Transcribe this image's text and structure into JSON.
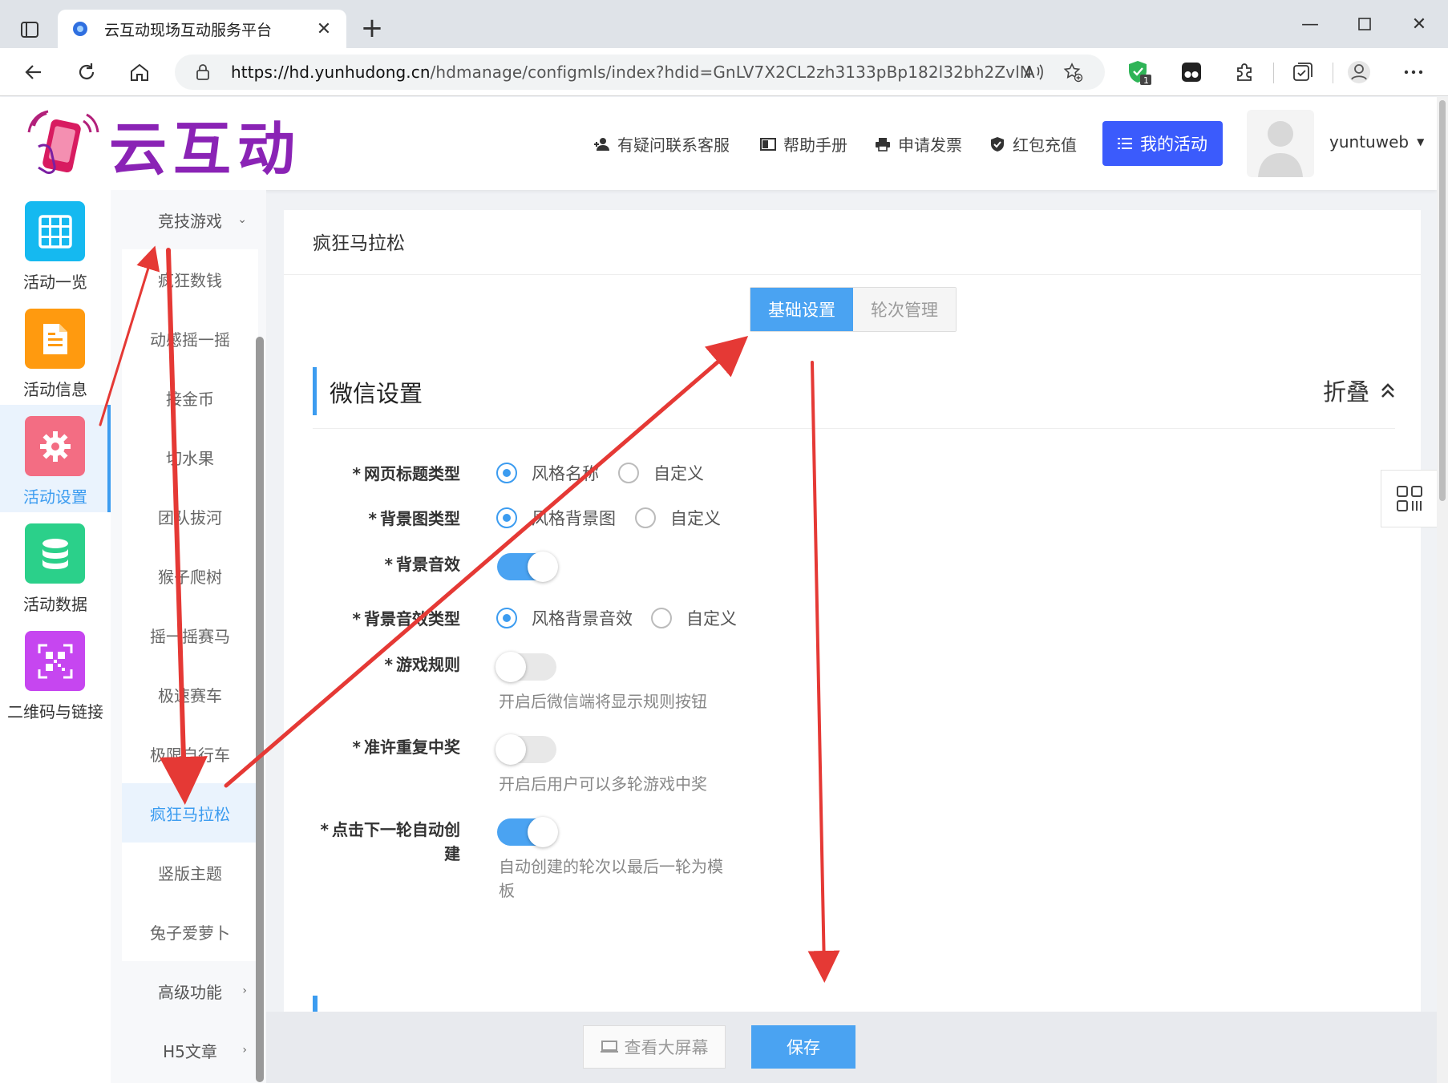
{
  "browser": {
    "tab_title": "云互动现场互动服务平台",
    "url_host": "https://hd.yunhudong.cn",
    "url_path": "/hdmanage/configmls/index?hdid=GnLV7X2CL2zh3133pBp182l32bh2ZvlN",
    "extension_badge": "1"
  },
  "header": {
    "logo_text": "云互动",
    "links": [
      "有疑问联系客服",
      "帮助手册",
      "申请发票",
      "红包充值"
    ],
    "my_activity": "我的活动",
    "username": "yuntuweb"
  },
  "icon_nav": [
    {
      "label": "活动一览",
      "color": "#15b9f0"
    },
    {
      "label": "活动信息",
      "color": "#ff9a0f"
    },
    {
      "label": "活动设置",
      "color": "#f36d83"
    },
    {
      "label": "活动数据",
      "color": "#2bd08a"
    },
    {
      "label": "二维码与链接",
      "color": "#c646f0"
    }
  ],
  "submenu": {
    "group": "竞技游戏",
    "items": [
      "疯狂数钱",
      "动感摇一摇",
      "接金币",
      "切水果",
      "团队拔河",
      "猴子爬树",
      "摇一摇赛马",
      "极速赛车",
      "极限自行车",
      "疯狂马拉松",
      "竖版主题",
      "兔子爱萝卜"
    ],
    "advanced": "高级功能",
    "h5": "H5文章"
  },
  "main": {
    "page_title": "疯狂马拉松",
    "tabs": [
      "基础设置",
      "轮次管理"
    ],
    "section_title": "微信设置",
    "collapse_label": "折叠",
    "fields": {
      "title_type": {
        "label": "网页标题类型",
        "options": [
          "风格名称",
          "自定义"
        ]
      },
      "bg_type": {
        "label": "背景图类型",
        "options": [
          "风格背景图",
          "自定义"
        ]
      },
      "bg_sound": {
        "label": "背景音效"
      },
      "bg_sound_type": {
        "label": "背景音效类型",
        "options": [
          "风格背景音效",
          "自定义"
        ]
      },
      "rules": {
        "label": "游戏规则",
        "hint": "开启后微信端将显示规则按钮"
      },
      "repeat_win": {
        "label": "准许重复中奖",
        "hint": "开启后用户可以多轮游戏中奖"
      },
      "auto_next": {
        "label_line1": "点击下一轮自动创",
        "label_line2": "建",
        "hint_line1": "自动创建的轮次以最后一轮为模",
        "hint_line2": "板"
      }
    }
  },
  "bottom": {
    "view_screen": "查看大屏幕",
    "save": "保存"
  },
  "colors": {
    "accent": "#3c9cf0",
    "primary_button": "#3b5bfc",
    "arrow": "#e53935"
  }
}
